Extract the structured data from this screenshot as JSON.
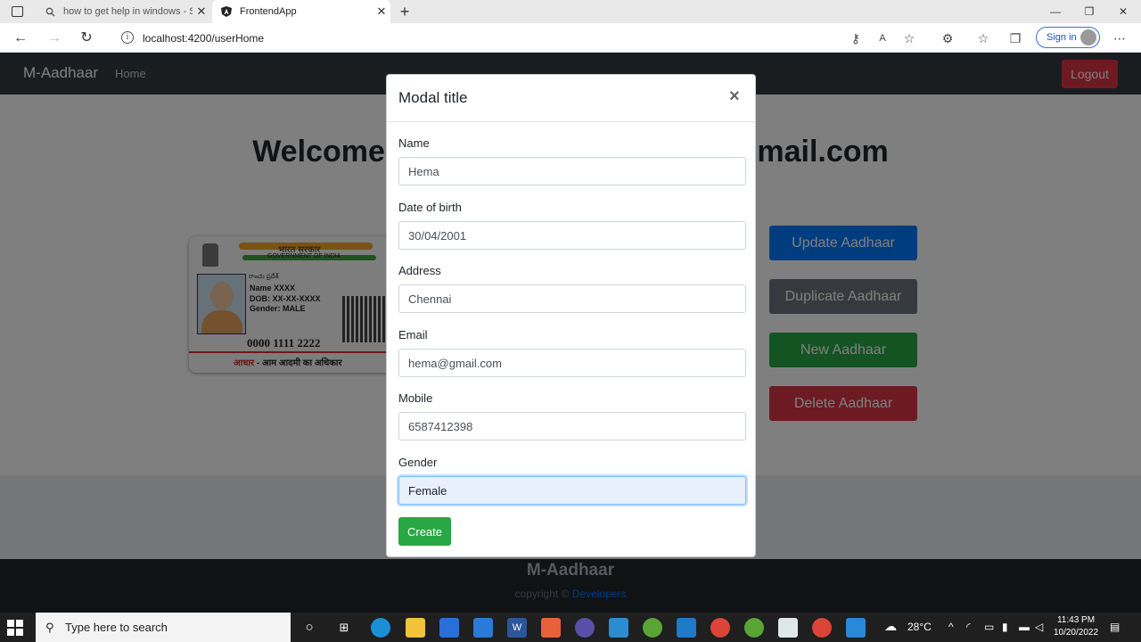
{
  "browser": {
    "tabs": [
      {
        "label": "how to get help in windows - Se",
        "icon": "search-icon"
      },
      {
        "label": "FrontendApp",
        "icon": "angular-icon"
      }
    ],
    "url": "localhost:4200/userHome",
    "sign_in": "Sign in"
  },
  "navbar": {
    "brand": "M-Aadhaar",
    "home": "Home",
    "logout": "Logout"
  },
  "page": {
    "welcome_left": "Welcome t",
    "welcome_right": "gmail.com",
    "card": {
      "hindi_title": "भारत सरकार",
      "gov_label": "GOVERNMENT OF INDIA",
      "telugu": "రాంచు ప్రదేశ్",
      "name_line": "Name XXXX",
      "dob_line": "DOB: XX-XX-XXXX",
      "gender_line": "Gender: MALE",
      "number": "0000 1111 2222",
      "tagline_red": "आधार",
      "tagline": " - आम आदमी का अधिकार"
    },
    "buttons": {
      "update": "Update Aadhaar",
      "duplicate": "Duplicate Aadhaar",
      "new": "New Aadhaar",
      "delete": "Delete Aadhaar"
    }
  },
  "footer": {
    "title": "M-Aadhaar",
    "copyright": "copyright ©",
    "link": "Developers"
  },
  "modal": {
    "title": "Modal title",
    "close": "×",
    "fields": [
      {
        "label": "Name",
        "value": "Hema"
      },
      {
        "label": "Date of birth",
        "value": "30/04/2001"
      },
      {
        "label": "Address",
        "value": "Chennai"
      },
      {
        "label": "Email",
        "value": "hema@gmail.com"
      },
      {
        "label": "Mobile",
        "value": "6587412398"
      },
      {
        "label": "Gender",
        "value": "Female"
      }
    ],
    "submit": "Create"
  },
  "taskbar": {
    "search_placeholder": "Type here to search",
    "weather": "28°C",
    "time": "11:43 PM",
    "date": "10/20/2022"
  },
  "colors": {
    "navbar": "#343a40",
    "primary": "#007bff",
    "secondary": "#6c757d",
    "success": "#28a745",
    "danger": "#dc3545"
  }
}
